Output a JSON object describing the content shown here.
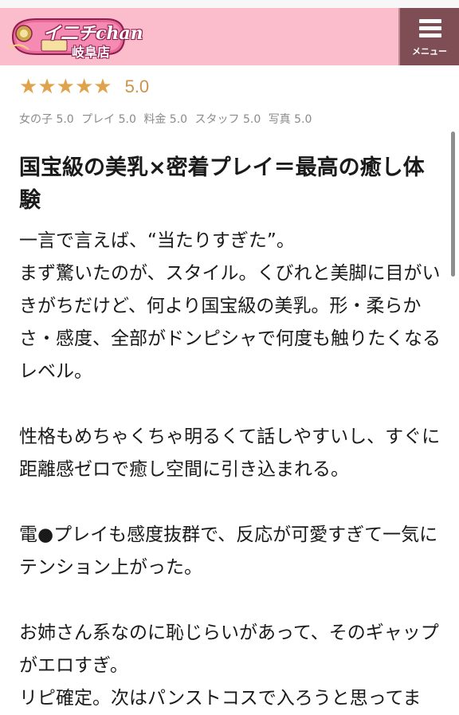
{
  "header": {
    "logo_text": "イ二チchan",
    "logo_sub": "岐阜店",
    "menu_label": "メニュー"
  },
  "rating": {
    "stars": 5,
    "score": "5.0",
    "sub_ratings": [
      "女の子 5.0",
      "プレイ 5.0",
      "料金 5.0",
      "スタッフ 5.0",
      "写真 5.0"
    ]
  },
  "review": {
    "title": "国宝級の美乳×密着プレイ＝最高の癒し体験",
    "paragraphs": [
      "一言で言えば、“当たりすぎた”。",
      "まず驚いたのが、スタイル。くびれと美脚に目がいきがちだけど、何より国宝級の美乳。形・柔らかさ・感度、全部がドンピシャで何度も触りたくなるレベル。",
      "",
      "性格もめちゃくちゃ明るくて話しやすいし、すぐに距離感ゼロで癒し空間に引き込まれる。",
      "",
      "電●プレイも感度抜群で、反応が可愛すぎて一気にテンション上がった。",
      "",
      "お姉さん系なのに恥じらいがあって、そのギャップがエロすぎ。",
      "リピ確定。次はパンストコスで入ろうと思ってま"
    ]
  },
  "colors": {
    "header_bg": "#fbbccb",
    "menu_bg": "#7f4e55",
    "star": "#e0a24a",
    "score": "#c9944f"
  }
}
